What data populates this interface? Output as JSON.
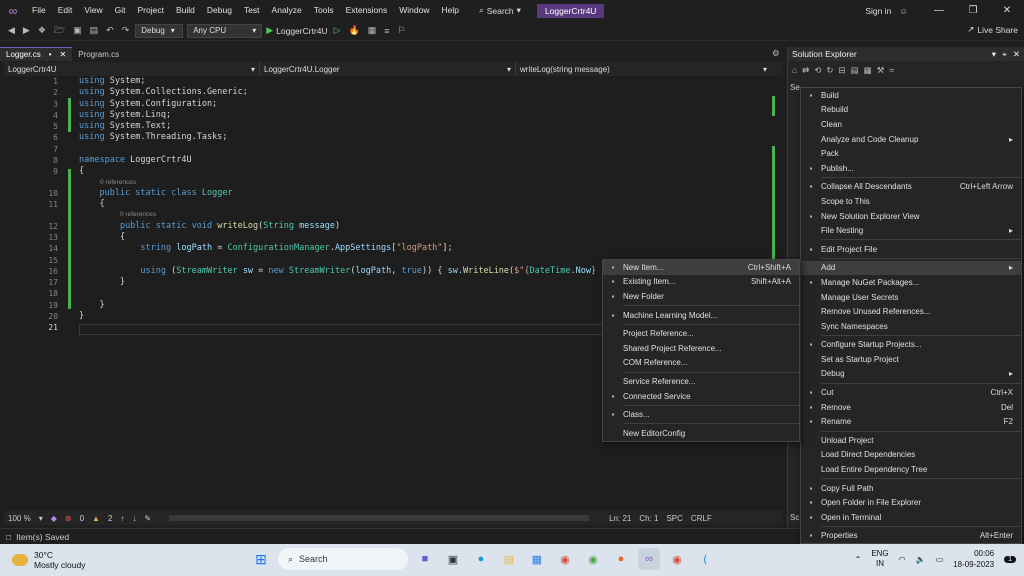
{
  "titlebar": {
    "menu": [
      "File",
      "Edit",
      "View",
      "Git",
      "Project",
      "Build",
      "Debug",
      "Test",
      "Analyze",
      "Tools",
      "Extensions",
      "Window",
      "Help"
    ],
    "search": "Search",
    "solution_name": "LoggerCrtr4U",
    "sign_in": "Sign in"
  },
  "toolbar": {
    "config": "Debug",
    "platform": "Any CPU",
    "run_target": "LoggerCrtr4U",
    "live_share": "Live Share"
  },
  "tabs": [
    {
      "label": "Logger.cs",
      "active": true
    },
    {
      "label": "Program.cs",
      "active": false
    }
  ],
  "navbar": {
    "project": "LoggerCrtr4U",
    "type": "LoggerCrtr4U.Logger",
    "member": "writeLog(string message)"
  },
  "code": {
    "line_numbers": [
      "1",
      "2",
      "3",
      "4",
      "5",
      "6",
      "7",
      "8",
      "9",
      "10",
      "11",
      "12",
      "13",
      "14",
      "15",
      "16",
      "17",
      "18",
      "19",
      "20",
      "21"
    ],
    "lines": [
      [
        {
          "c": "kw",
          "t": "using"
        },
        {
          "c": "",
          "t": " System;"
        }
      ],
      [
        {
          "c": "kw",
          "t": "using"
        },
        {
          "c": "",
          "t": " System.Collections.Generic;"
        }
      ],
      [
        {
          "c": "kw",
          "t": "using"
        },
        {
          "c": "",
          "t": " System.Configuration;"
        }
      ],
      [
        {
          "c": "kw",
          "t": "using"
        },
        {
          "c": "",
          "t": " System.Linq;"
        }
      ],
      [
        {
          "c": "kw",
          "t": "using"
        },
        {
          "c": "",
          "t": " System.Text;"
        }
      ],
      [
        {
          "c": "kw",
          "t": "using"
        },
        {
          "c": "",
          "t": " System.Threading.Tasks;"
        }
      ],
      [],
      [
        {
          "c": "kw",
          "t": "namespace"
        },
        {
          "c": "",
          "t": " LoggerCrtr4U"
        }
      ],
      [
        {
          "c": "",
          "t": "{"
        }
      ],
      [
        {
          "c": "",
          "t": "    "
        },
        {
          "c": "kw",
          "t": "public static class"
        },
        {
          "c": "",
          "t": " "
        },
        {
          "c": "ty",
          "t": "Logger"
        }
      ],
      [
        {
          "c": "",
          "t": "    {"
        }
      ],
      [
        {
          "c": "",
          "t": "        "
        },
        {
          "c": "kw",
          "t": "public static void"
        },
        {
          "c": "",
          "t": " "
        },
        {
          "c": "fn",
          "t": "writeLog"
        },
        {
          "c": "",
          "t": "("
        },
        {
          "c": "ty",
          "t": "String"
        },
        {
          "c": "",
          "t": " "
        },
        {
          "c": "vr",
          "t": "message"
        },
        {
          "c": "",
          "t": ")"
        }
      ],
      [
        {
          "c": "",
          "t": "        {"
        }
      ],
      [
        {
          "c": "",
          "t": "            "
        },
        {
          "c": "kw",
          "t": "string"
        },
        {
          "c": "",
          "t": " "
        },
        {
          "c": "vr",
          "t": "logPath"
        },
        {
          "c": "",
          "t": " = "
        },
        {
          "c": "ty",
          "t": "ConfigurationManager"
        },
        {
          "c": "",
          "t": "."
        },
        {
          "c": "vr",
          "t": "AppSettings"
        },
        {
          "c": "",
          "t": "["
        },
        {
          "c": "st",
          "t": "\"logPath\""
        },
        {
          "c": "",
          "t": "];"
        }
      ],
      [],
      [
        {
          "c": "",
          "t": "            "
        },
        {
          "c": "kw",
          "t": "using"
        },
        {
          "c": "",
          "t": " ("
        },
        {
          "c": "ty",
          "t": "StreamWriter"
        },
        {
          "c": "",
          "t": " "
        },
        {
          "c": "vr",
          "t": "sw"
        },
        {
          "c": "",
          "t": " = "
        },
        {
          "c": "kw",
          "t": "new"
        },
        {
          "c": "",
          "t": " "
        },
        {
          "c": "ty",
          "t": "StreamWriter"
        },
        {
          "c": "",
          "t": "("
        },
        {
          "c": "vr",
          "t": "logPath"
        },
        {
          "c": "",
          "t": ", "
        },
        {
          "c": "kw",
          "t": "true"
        },
        {
          "c": "",
          "t": ")) { "
        },
        {
          "c": "vr",
          "t": "sw"
        },
        {
          "c": "",
          "t": "."
        },
        {
          "c": "fn",
          "t": "WriteLine"
        },
        {
          "c": "",
          "t": "("
        },
        {
          "c": "st",
          "t": "$\"{"
        },
        {
          "c": "ty",
          "t": "DateTime"
        },
        {
          "c": "",
          "t": "."
        },
        {
          "c": "vr",
          "t": "Now"
        },
        {
          "c": "st",
          "t": "}"
        },
        {
          "c": "",
          "t": " :"
        }
      ],
      [
        {
          "c": "",
          "t": "        }"
        }
      ],
      [],
      [
        {
          "c": "",
          "t": "    }"
        }
      ],
      [
        {
          "c": "",
          "t": "}"
        }
      ],
      []
    ],
    "refs": [
      "0 references",
      "0 references"
    ]
  },
  "editor_status": {
    "zoom": "100 %",
    "errors": "0",
    "warnings": "2",
    "line": "Ln: 21",
    "col": "Ch: 1",
    "spc": "SPC",
    "crlf": "CRLF"
  },
  "status_bar": {
    "text": "Item(s) Saved"
  },
  "solution_explorer": {
    "title": "Solution Explorer",
    "search_prefix": "Se",
    "below_prefix": "Sc"
  },
  "context_menu": [
    {
      "label": "Build",
      "icon": "build-icon",
      "shortcut": ""
    },
    {
      "label": "Rebuild",
      "icon": "",
      "shortcut": ""
    },
    {
      "label": "Clean",
      "icon": "",
      "shortcut": ""
    },
    {
      "label": "Analyze and Code Cleanup",
      "icon": "",
      "shortcut": "",
      "sub": true
    },
    {
      "label": "Pack",
      "icon": "",
      "shortcut": ""
    },
    {
      "label": "Publish...",
      "icon": "publish-icon",
      "shortcut": ""
    },
    {
      "sep": true
    },
    {
      "label": "Collapse All Descendants",
      "icon": "collapse-icon",
      "shortcut": "Ctrl+Left Arrow"
    },
    {
      "label": "Scope to This",
      "icon": "",
      "shortcut": ""
    },
    {
      "label": "New Solution Explorer View",
      "icon": "new-view-icon",
      "shortcut": ""
    },
    {
      "label": "File Nesting",
      "icon": "",
      "shortcut": "",
      "sub": true
    },
    {
      "sep": true
    },
    {
      "label": "Edit Project File",
      "icon": "edit-file-icon",
      "shortcut": ""
    },
    {
      "sep": true
    },
    {
      "label": "Add",
      "icon": "",
      "shortcut": "",
      "sub": true,
      "hl": true
    },
    {
      "label": "Manage NuGet Packages...",
      "icon": "nuget-icon",
      "shortcut": ""
    },
    {
      "label": "Manage User Secrets",
      "icon": "",
      "shortcut": ""
    },
    {
      "label": "Remove Unused References...",
      "icon": "",
      "shortcut": ""
    },
    {
      "label": "Sync Namespaces",
      "icon": "",
      "shortcut": ""
    },
    {
      "sep": true
    },
    {
      "label": "Configure Startup Projects...",
      "icon": "gear-icon",
      "shortcut": ""
    },
    {
      "label": "Set as Startup Project",
      "icon": "",
      "shortcut": ""
    },
    {
      "label": "Debug",
      "icon": "",
      "shortcut": "",
      "sub": true
    },
    {
      "sep": true
    },
    {
      "label": "Cut",
      "icon": "cut-icon",
      "shortcut": "Ctrl+X"
    },
    {
      "label": "Remove",
      "icon": "remove-icon",
      "shortcut": "Del"
    },
    {
      "label": "Rename",
      "icon": "rename-icon",
      "shortcut": "F2"
    },
    {
      "sep": true
    },
    {
      "label": "Unload Project",
      "icon": "",
      "shortcut": ""
    },
    {
      "label": "Load Direct Dependencies",
      "icon": "",
      "shortcut": ""
    },
    {
      "label": "Load Entire Dependency Tree",
      "icon": "",
      "shortcut": ""
    },
    {
      "sep": true
    },
    {
      "label": "Copy Full Path",
      "icon": "copy-icon",
      "shortcut": ""
    },
    {
      "label": "Open Folder in File Explorer",
      "icon": "open-folder-icon",
      "shortcut": ""
    },
    {
      "label": "Open in Terminal",
      "icon": "terminal-icon",
      "shortcut": ""
    },
    {
      "sep": true
    },
    {
      "label": "Properties",
      "icon": "wrench-icon",
      "shortcut": "Alt+Enter"
    }
  ],
  "add_submenu": [
    {
      "label": "New Item...",
      "icon": "new-item-icon",
      "shortcut": "Ctrl+Shift+A",
      "hl": true
    },
    {
      "label": "Existing Item...",
      "icon": "existing-item-icon",
      "shortcut": "Shift+Alt+A"
    },
    {
      "label": "New Folder",
      "icon": "folder-icon",
      "shortcut": ""
    },
    {
      "sep": true
    },
    {
      "label": "Machine Learning Model...",
      "icon": "ml-model-icon",
      "shortcut": ""
    },
    {
      "sep": true
    },
    {
      "label": "Project Reference...",
      "icon": "",
      "shortcut": ""
    },
    {
      "label": "Shared Project Reference...",
      "icon": "",
      "shortcut": ""
    },
    {
      "label": "COM Reference...",
      "icon": "",
      "shortcut": ""
    },
    {
      "sep": true
    },
    {
      "label": "Service Reference...",
      "icon": "",
      "shortcut": ""
    },
    {
      "label": "Connected Service",
      "icon": "connected-service-icon",
      "shortcut": ""
    },
    {
      "sep": true
    },
    {
      "label": "Class...",
      "icon": "class-icon",
      "shortcut": ""
    },
    {
      "sep": true
    },
    {
      "label": "New EditorConfig",
      "icon": "",
      "shortcut": ""
    }
  ],
  "taskbar": {
    "temp": "30°C",
    "weather": "Mostly cloudy",
    "search": "Search",
    "lang1": "ENG",
    "lang2": "IN",
    "time": "00:06",
    "date": "18-09-2023",
    "notif_count": "1"
  },
  "colors": {
    "accent": "#7b5cc7",
    "change_bar": "#4caf50",
    "taskbar": "#dbe4ec"
  }
}
